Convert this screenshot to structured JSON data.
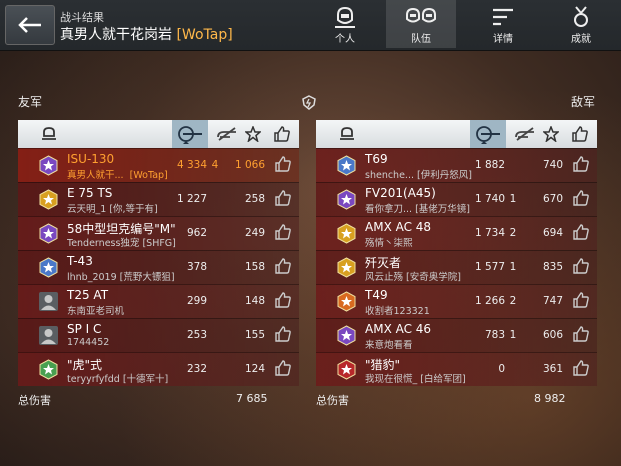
{
  "header": {
    "subtitle": "战斗结果",
    "player": "真男人就干花岗岩",
    "clan": "[WoTap]",
    "tabs": [
      {
        "label": "个人",
        "icon": "person-icon",
        "active": false
      },
      {
        "label": "队伍",
        "icon": "team-icon",
        "active": true
      },
      {
        "label": "详情",
        "icon": "details-icon",
        "active": false
      },
      {
        "label": "成就",
        "icon": "medal-icon",
        "active": false
      }
    ]
  },
  "allies_label": "友军",
  "enemies_label": "敌军",
  "allies": [
    {
      "tank": "ISU-130",
      "player": "真男人就干...",
      "clan": "[WoTap]",
      "damage": "4 334",
      "kills": "4",
      "exp": "1 066",
      "highlight": true,
      "badge": "purple"
    },
    {
      "tank": "E 75 TS",
      "player": "云天明_1 [你,等于有]",
      "clan": "",
      "damage": "1 227",
      "kills": "",
      "exp": "258",
      "highlight": false,
      "badge": "gold"
    },
    {
      "tank": "58中型坦克编号\"M\"",
      "player": "Tenderness独宠 [SHFG]",
      "clan": "",
      "damage": "962",
      "kills": "",
      "exp": "249",
      "highlight": false,
      "badge": "purple"
    },
    {
      "tank": "T-43",
      "player": "lhnb_2019 [荒野大镖狙]",
      "clan": "",
      "damage": "378",
      "kills": "",
      "exp": "158",
      "highlight": false,
      "badge": "blue"
    },
    {
      "tank": "T25 AT",
      "player": "东南亚老司机",
      "clan": "",
      "damage": "299",
      "kills": "",
      "exp": "148",
      "highlight": false,
      "badge": "gray"
    },
    {
      "tank": "SP I C",
      "player": "1744452",
      "clan": "",
      "damage": "253",
      "kills": "",
      "exp": "155",
      "highlight": false,
      "badge": "gray"
    },
    {
      "tank": "\"虎\"式",
      "player": "teryyrfyfdd [十德军十]",
      "clan": "",
      "damage": "232",
      "kills": "",
      "exp": "124",
      "highlight": false,
      "badge": "green"
    }
  ],
  "enemies": [
    {
      "tank": "T69",
      "player": "shenche... [伊利丹怒风]",
      "damage": "1 882",
      "kills": "",
      "exp": "740",
      "badge": "blue"
    },
    {
      "tank": "FV201(A45)",
      "player": "看你拿刀... [基佬万华镜]",
      "damage": "1 740",
      "kills": "1",
      "exp": "670",
      "badge": "purple"
    },
    {
      "tank": "AMX AC 48",
      "player": "殇情丶柒熙",
      "damage": "1 734",
      "kills": "2",
      "exp": "694",
      "badge": "gold"
    },
    {
      "tank": "歼灭者",
      "player": "风云止殇 [安奇奥学院]",
      "damage": "1 577",
      "kills": "1",
      "exp": "835",
      "badge": "gold"
    },
    {
      "tank": "T49",
      "player": "收割者123321",
      "damage": "1 266",
      "kills": "2",
      "exp": "747",
      "badge": "orange"
    },
    {
      "tank": "AMX AC 46",
      "player": "来意炮看看",
      "damage": "783",
      "kills": "1",
      "exp": "606",
      "badge": "purple"
    },
    {
      "tank": "\"猎豹\"",
      "player": "我现在很慌_ [白给军团]",
      "damage": "0",
      "kills": "",
      "exp": "361",
      "badge": "red"
    }
  ],
  "totals": {
    "label": "总伤害",
    "allies": "7 685",
    "enemies": "8 982"
  },
  "colors": {
    "highlight": "#ffa030",
    "header_selected": "#9fb6c4",
    "row_red": "#6e1919"
  }
}
